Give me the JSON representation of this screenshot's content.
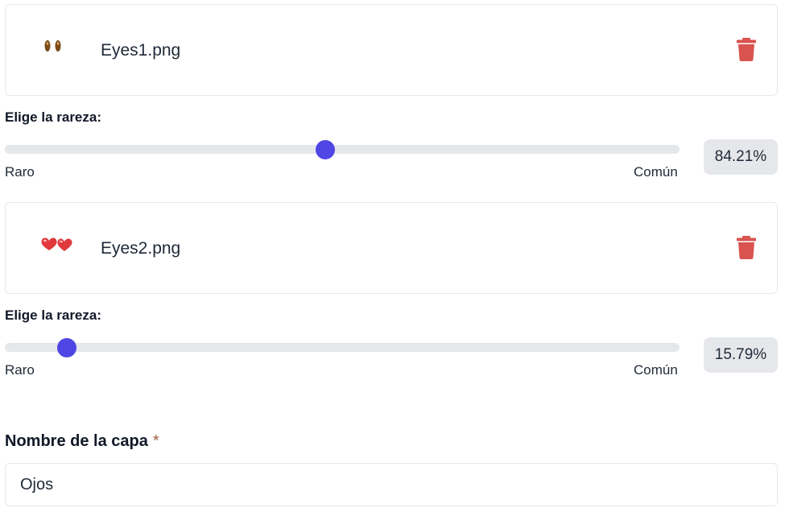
{
  "layers": [
    {
      "file_name": "Eyes1.png",
      "thumb_icon": "brown-eyes-icon",
      "delete_icon": "trash-icon",
      "rarity_label": "Elige la rareza:",
      "slider_min_label": "Raro",
      "slider_max_label": "Común",
      "slider_value": 0.475,
      "percentage": "84.21%"
    },
    {
      "file_name": "Eyes2.png",
      "thumb_icon": "heart-eyes-icon",
      "delete_icon": "trash-icon",
      "rarity_label": "Elige la rareza:",
      "slider_min_label": "Raro",
      "slider_max_label": "Común",
      "slider_value": 0.092,
      "percentage": "15.79%"
    }
  ],
  "layer_name": {
    "label": "Nombre de la capa",
    "required_marker": "*",
    "value": "Ojos"
  },
  "colors": {
    "accent": "#4f46e5",
    "danger": "#d9534f",
    "track": "#e5e7eb"
  }
}
